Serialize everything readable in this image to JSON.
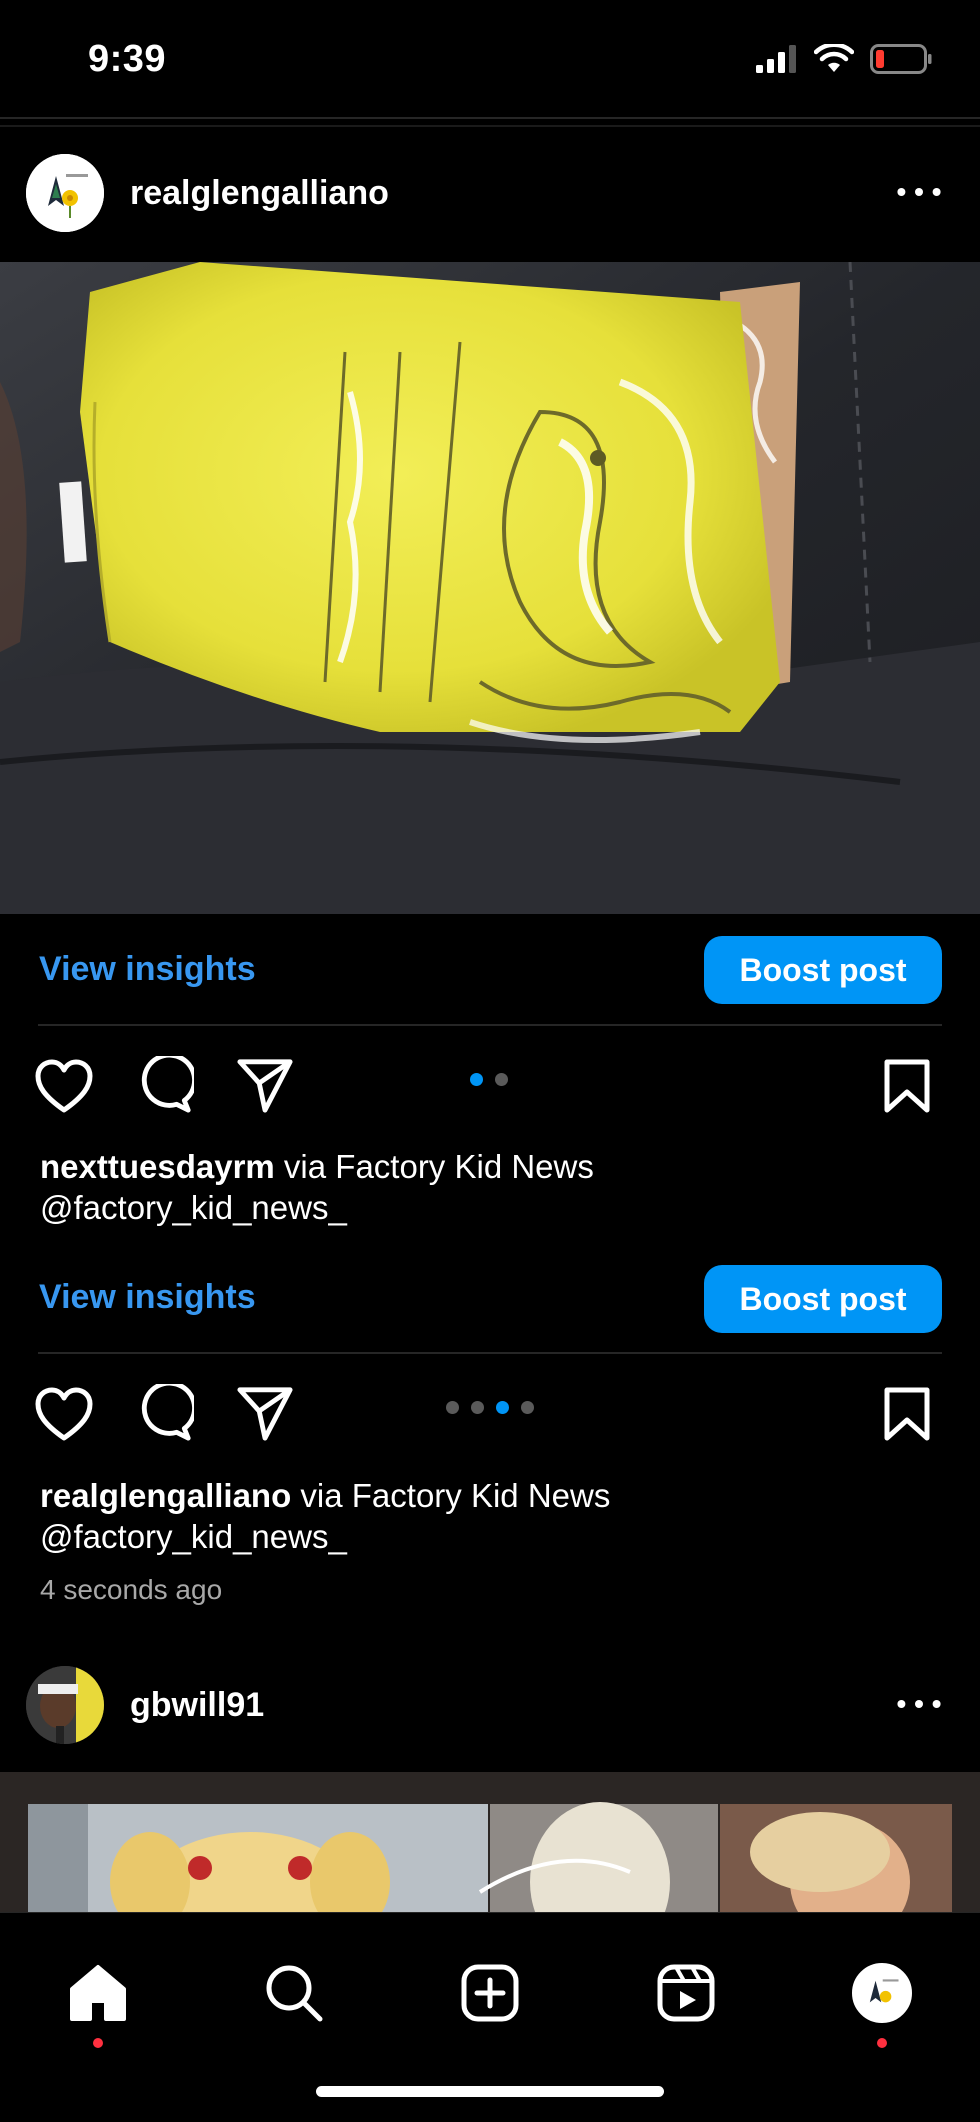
{
  "status_bar": {
    "time": "9:39"
  },
  "post1": {
    "username": "realglengalliano",
    "view_insights": "View insights",
    "boost_label": "Boost post"
  },
  "post2": {
    "caption_user": "nexttuesdayrm",
    "caption_rest": " via Factory Kid News",
    "caption_line2": "@factory_kid_news_",
    "view_insights": "View insights",
    "boost_label": "Boost post"
  },
  "post3": {
    "caption_user": "realglengalliano",
    "caption_rest": " via Factory Kid News",
    "caption_line2": "@factory_kid_news_",
    "timestamp": "4 seconds ago"
  },
  "post4": {
    "username": "gbwill91"
  },
  "colors": {
    "accent": "#0095f6",
    "link": "#3897f0",
    "notification": "#ff3040"
  },
  "icons": [
    "signal-icon",
    "wifi-icon",
    "battery-icon",
    "more-icon",
    "heart-icon",
    "comment-icon",
    "share-icon",
    "bookmark-icon",
    "home-icon",
    "search-icon",
    "create-icon",
    "reels-icon",
    "profile-icon"
  ]
}
